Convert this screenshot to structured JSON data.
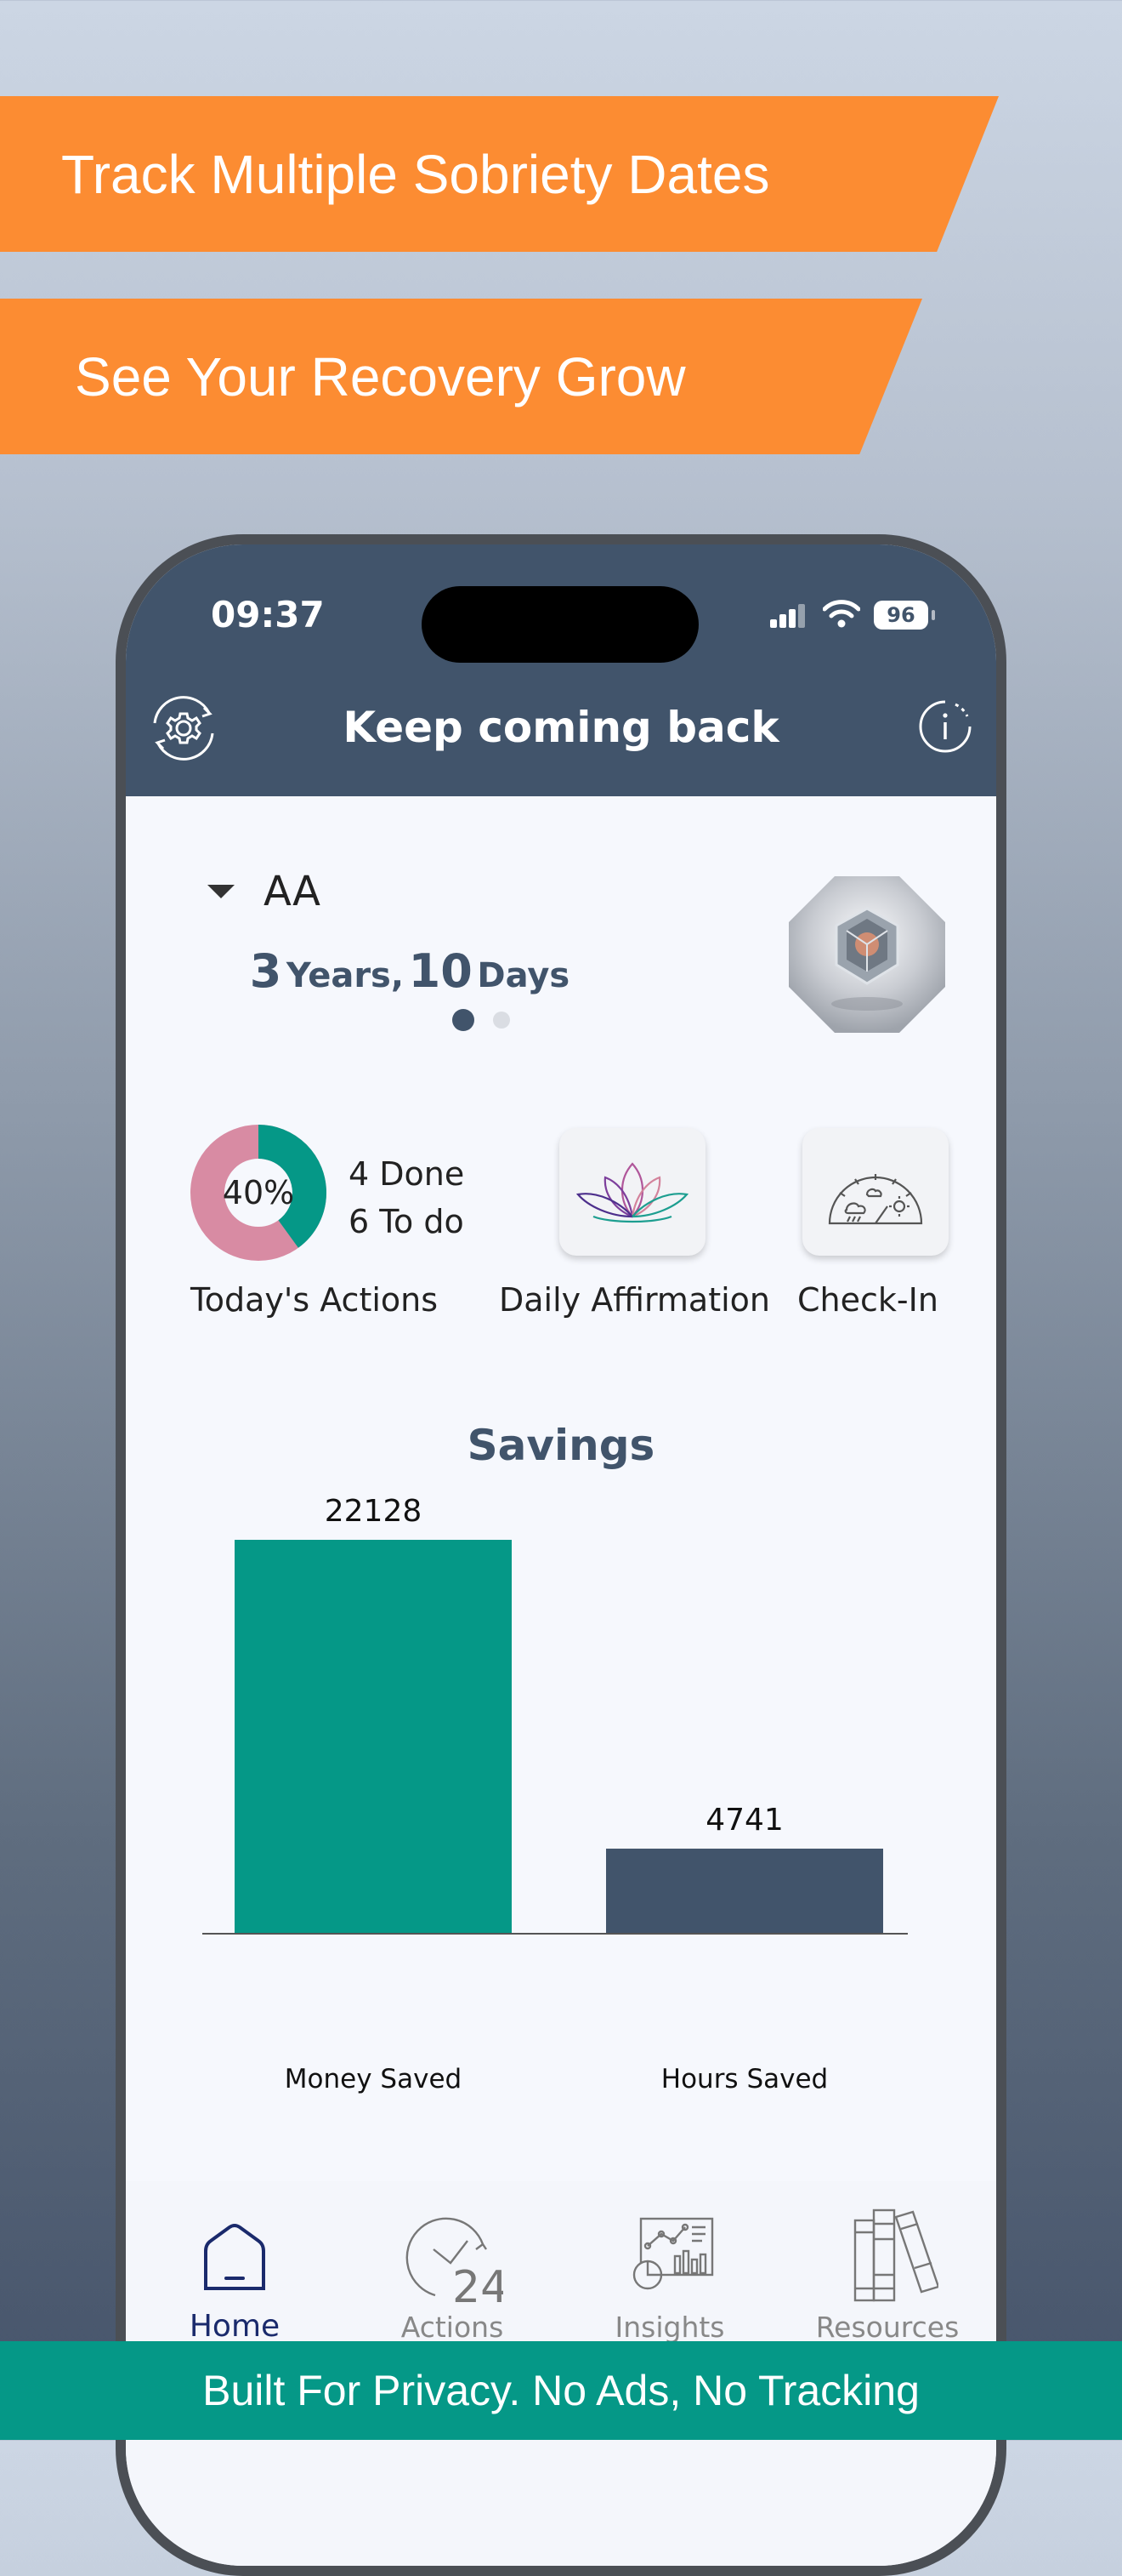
{
  "promo": {
    "banner1": "Track Multiple Sobriety Dates",
    "banner2": "See Your Recovery Grow",
    "footer": "Built For Privacy. No Ads, No Tracking"
  },
  "status_bar": {
    "time": "09:37",
    "battery": "96"
  },
  "header": {
    "title": "Keep coming back",
    "settings_icon": "gear-refresh-icon",
    "info_icon": "info-icon"
  },
  "program": {
    "name": "AA",
    "years": "3",
    "years_unit": "Years,",
    "days": "10",
    "days_unit": "Days",
    "page_dots": 2,
    "active_dot": 0
  },
  "actions_progress": {
    "percent_label": "40%",
    "done": "4 Done",
    "todo": "6 To do",
    "fraction_done": 0.4
  },
  "quick_actions": [
    {
      "label": "Today's Actions"
    },
    {
      "label": "Daily Affirmation",
      "icon": "lotus-icon"
    },
    {
      "label": "Check-In",
      "icon": "weather-gauge-icon"
    }
  ],
  "savings": {
    "title": "Savings"
  },
  "chart_data": {
    "type": "bar",
    "title": "Savings",
    "categories": [
      "Money Saved",
      "Hours Saved"
    ],
    "values": [
      22128,
      4741
    ],
    "colors": [
      "#059887",
      "#41546b"
    ],
    "ylim": [
      0,
      22128
    ],
    "grid": false
  },
  "tabs": [
    {
      "label": "Home",
      "icon": "home-icon",
      "active": true
    },
    {
      "label": "Actions",
      "icon": "clock-24-icon",
      "active": false
    },
    {
      "label": "Insights",
      "icon": "chart-board-icon",
      "active": false
    },
    {
      "label": "Resources",
      "icon": "books-icon",
      "active": false
    }
  ],
  "colors": {
    "accent_orange": "#fc8c32",
    "teal": "#059887",
    "navy": "#41546b",
    "pink": "#d88ba3"
  }
}
